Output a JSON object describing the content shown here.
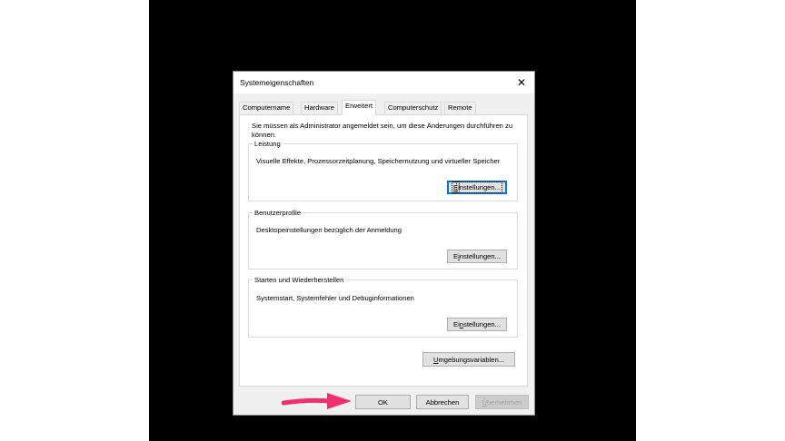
{
  "dialog": {
    "title": "Systemeigenschaften",
    "close_label": "✕"
  },
  "tabs": [
    {
      "label": "Computername",
      "active": false
    },
    {
      "label": "Hardware",
      "active": false
    },
    {
      "label": "Erweitert",
      "active": true
    },
    {
      "label": "Computerschutz",
      "active": false
    },
    {
      "label": "Remote",
      "active": false
    }
  ],
  "admin_note": "Sie müssen als Administrator angemeldet sein, um diese Änderungen durchführen zu können.",
  "groups": {
    "performance": {
      "title": "Leistung",
      "description": "Visuelle Effekte, Prozessorzeitplanung, Speichernutzung und virtueller Speicher",
      "button": {
        "mnemonic": "E",
        "rest": "instellungen..."
      }
    },
    "profiles": {
      "title": "Benutzerprofile",
      "description": "Desktopeinstellungen bezüglich der Anmeldung",
      "button": {
        "pre": "E",
        "mnemonic": "i",
        "rest": "nstellungen..."
      }
    },
    "startup": {
      "title": "Starten und Wiederherstellen",
      "description": "Systemstart, Systemfehler und Debuginformationen",
      "button": {
        "pre": "Ei",
        "mnemonic": "n",
        "rest": "stellungen..."
      }
    }
  },
  "env_button": {
    "mnemonic": "U",
    "rest": "mgebungsvariablen..."
  },
  "footer": {
    "ok": "OK",
    "cancel": "Abbrechen",
    "apply_mnemonic": "Ü",
    "apply_rest": "bernehmen"
  },
  "colors": {
    "arrow": "#f0306e",
    "focus": "#0078d7",
    "background": "#000000"
  }
}
